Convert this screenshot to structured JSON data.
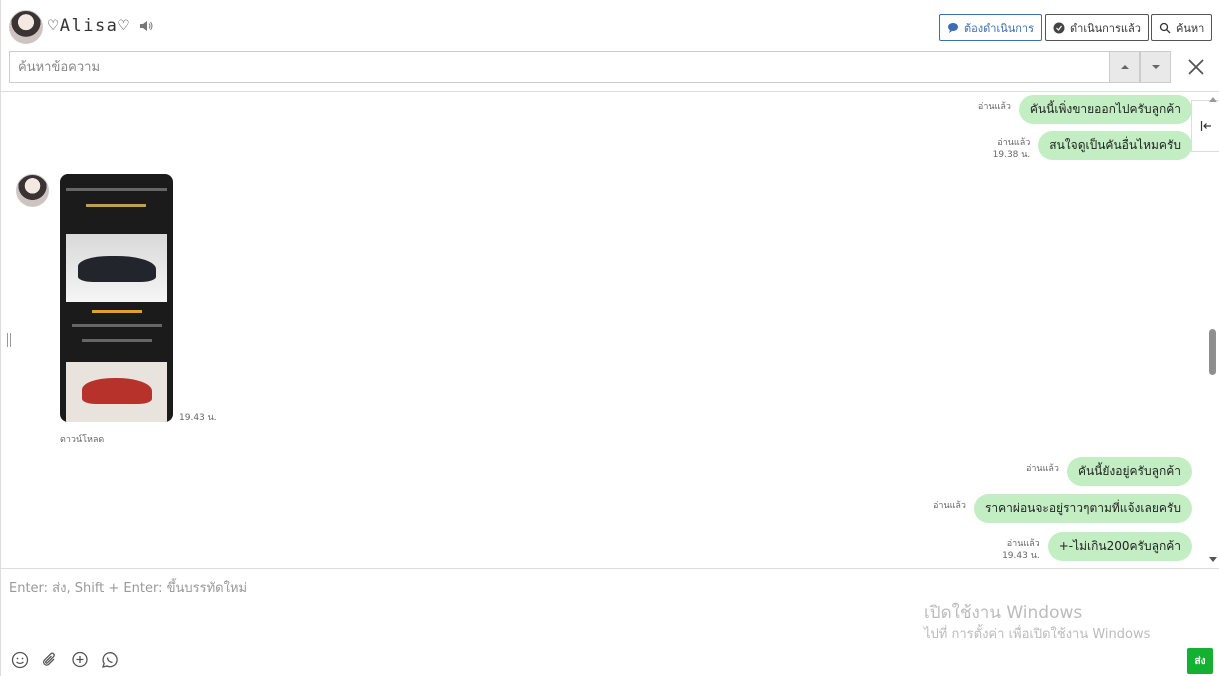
{
  "header": {
    "contact_name": "♡Alisa♡",
    "buttons": {
      "pending": "ต้องดำเนินการ",
      "done": "ดำเนินการแล้ว",
      "search": "ค้นหา"
    },
    "search": {
      "placeholder": "ค้นหาข้อความ"
    }
  },
  "messages": {
    "outgoing_top": [
      {
        "status": "อ่านแล้ว",
        "time": "",
        "text": "คันนี้เพิ่งขายออกไปครับลูกค้า"
      },
      {
        "status": "อ่านแล้ว",
        "time": "19.38 น.",
        "text": "สนใจดูเป็นคันอื่นไหมครับ"
      }
    ],
    "incoming_image": {
      "time": "19.43 น.",
      "download_label": "ดาวน์โหลด"
    },
    "outgoing_bottom": [
      {
        "status": "อ่านแล้ว",
        "time": "",
        "text": "คันนี้ยังอยู่ครับลูกค้า"
      },
      {
        "status": "อ่านแล้ว",
        "time": "",
        "text": "ราคาผ่อนจะอยู่ราวๆตามที่แจ้งเลยครับ"
      },
      {
        "status": "อ่านแล้ว",
        "time": "19.43 น.",
        "text": "+-ไม่เกิน200ครับลูกค้า"
      }
    ]
  },
  "composer": {
    "placeholder": "Enter: ส่ง, Shift + Enter: ขึ้นบรรทัดใหม่",
    "send_label": "ส่ง"
  },
  "watermark": {
    "title": "เปิดใช้งาน Windows",
    "subtitle": "ไปที่ การตั้งค่า เพื่อเปิดใช้งาน Windows"
  },
  "colors": {
    "bubble": "#c3eec4",
    "accent": "#3d6db5",
    "send": "#14b032"
  },
  "icons": [
    "speaker-icon",
    "chat-bubble-icon",
    "check-bubble-icon",
    "search-icon",
    "caret-up-icon",
    "caret-down-icon",
    "close-icon",
    "collapse-panel-icon",
    "emoji-icon",
    "paperclip-icon",
    "add-chat-icon",
    "whatsapp-icon"
  ]
}
